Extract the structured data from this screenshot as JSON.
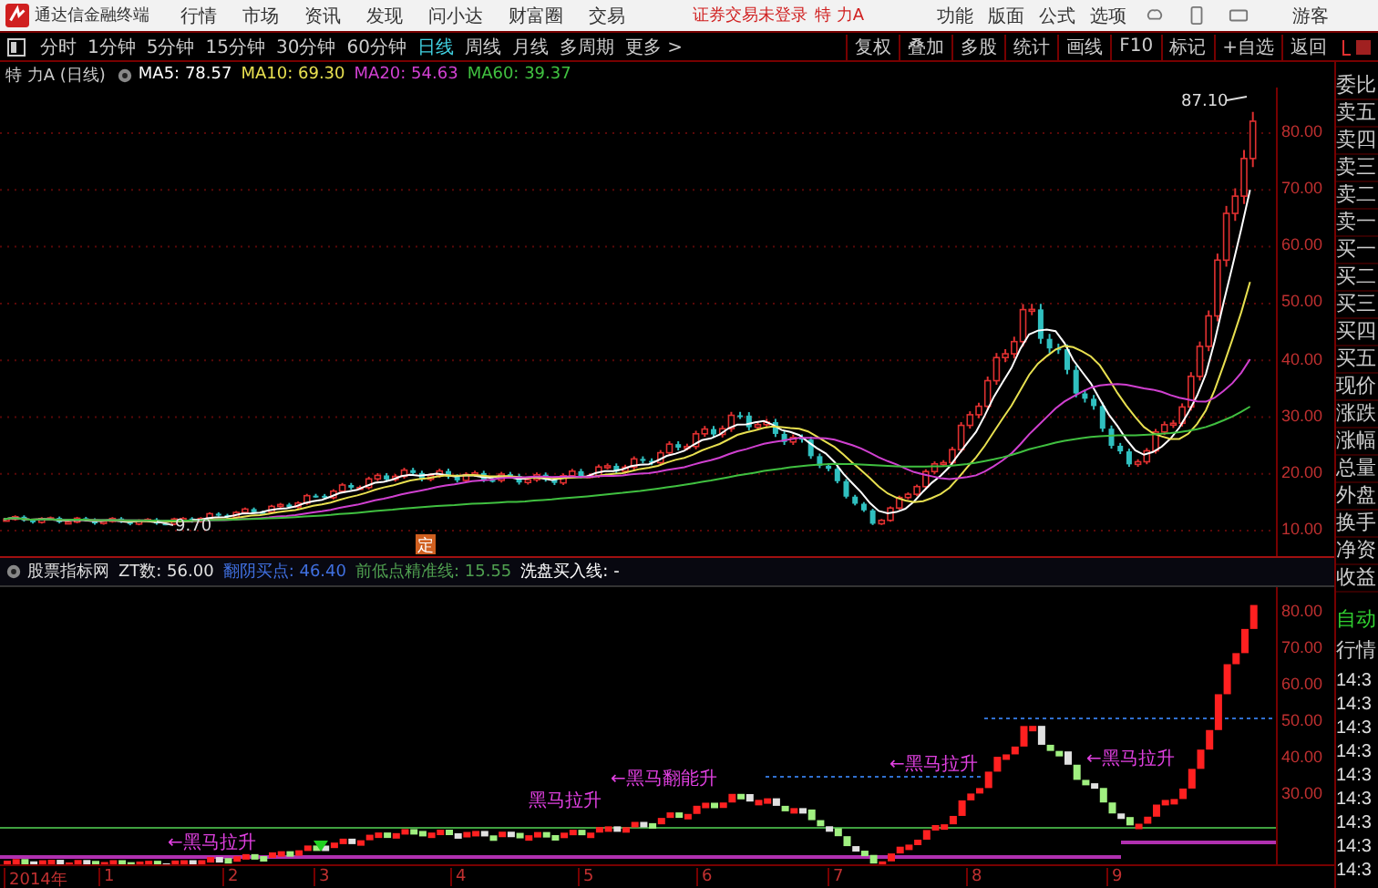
{
  "menubar": {
    "app_title": "通达信金融终端",
    "items": [
      "行情",
      "市场",
      "资讯",
      "发现",
      "问小达",
      "财富圈",
      "交易"
    ],
    "status": "证券交易未登录",
    "stock": "特 力A",
    "right_items": [
      "功能",
      "版面",
      "公式",
      "选项"
    ],
    "user": "游客"
  },
  "periods": [
    {
      "label": "分时",
      "selected": false
    },
    {
      "label": "1分钟",
      "selected": false
    },
    {
      "label": "5分钟",
      "selected": false
    },
    {
      "label": "15分钟",
      "selected": false
    },
    {
      "label": "30分钟",
      "selected": false
    },
    {
      "label": "60分钟",
      "selected": false
    },
    {
      "label": "日线",
      "selected": true
    },
    {
      "label": "周线",
      "selected": false
    },
    {
      "label": "月线",
      "selected": false
    },
    {
      "label": "多周期",
      "selected": false
    },
    {
      "label": "更多 >",
      "selected": false
    }
  ],
  "tools": [
    "复权",
    "叠加",
    "多股",
    "统计",
    "画线",
    "F10",
    "标记",
    "+自选",
    "返回"
  ],
  "info": {
    "title": "特 力A (日线)",
    "ma": [
      {
        "text": "MA5: 78.57",
        "color": "#ffffff"
      },
      {
        "text": "MA10: 69.30",
        "color": "#e8e050"
      },
      {
        "text": "MA20: 54.63",
        "color": "#d040d0"
      },
      {
        "text": "MA60: 39.37",
        "color": "#40c040"
      }
    ]
  },
  "price_axis": [
    "80.00",
    "70.00",
    "60.00",
    "50.00",
    "40.00",
    "30.00",
    "20.00",
    "10.00"
  ],
  "high_label": "87.10",
  "low_label": "9.70",
  "event_mark": "定",
  "indicator": {
    "name": "股票指标网",
    "values": [
      {
        "text": "ZT数: 56.00",
        "color": "#e0e0e0"
      },
      {
        "text": "翻阴买点: 46.40",
        "color": "#4070e0"
      },
      {
        "text": "前低点精准线: 15.55",
        "color": "#50a050"
      },
      {
        "text": "洗盘买入线: -",
        "color": "#ffffff"
      }
    ]
  },
  "signals": [
    "←黑马拉升",
    "黑马拉升",
    "←黑马翻能升",
    "←黑马拉升",
    "←黑马拉升"
  ],
  "lower_axis": [
    "80.00",
    "70.00",
    "60.00",
    "50.00",
    "40.00",
    "30.00"
  ],
  "dates": [
    "2014年",
    "1",
    "2",
    "3",
    "4",
    "5",
    "6",
    "7",
    "8",
    "9"
  ],
  "side": [
    "委比",
    "卖五",
    "卖四",
    "卖三",
    "卖二",
    "卖一",
    "买一",
    "买二",
    "买三",
    "买四",
    "买五",
    "现价",
    "涨跌",
    "涨幅",
    "总量",
    "外盘",
    "换手",
    "净资",
    "收益"
  ],
  "side_bottom": {
    "auto": "自动",
    "quote": "行情",
    "times": [
      "14:3",
      "14:3",
      "14:3",
      "14:3",
      "14:3",
      "14:3",
      "14:3",
      "14:3",
      "14:3"
    ]
  }
}
